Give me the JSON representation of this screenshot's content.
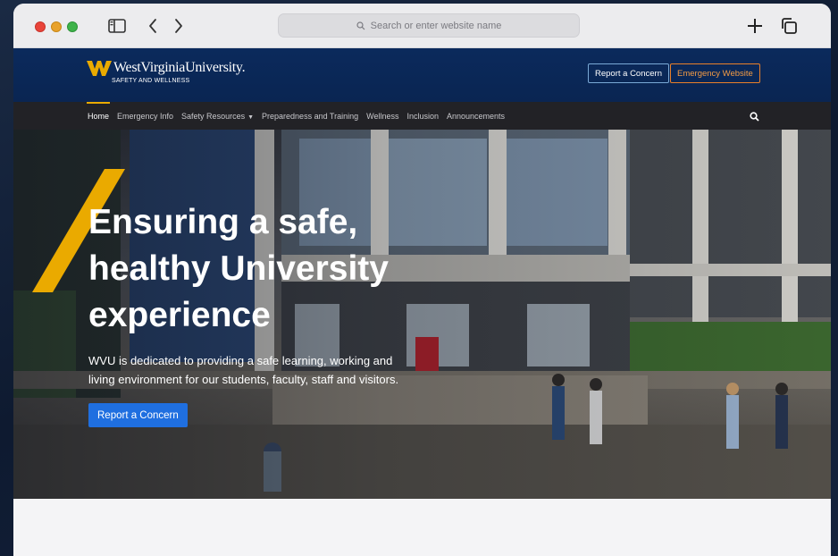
{
  "browser": {
    "url_placeholder": "Search or enter website name"
  },
  "header": {
    "university": "WestVirginiaUniversity.",
    "department": "SAFETY AND WELLNESS",
    "report_button": "Report a Concern",
    "emergency_button": "Emergency Website"
  },
  "nav": {
    "items": [
      {
        "label": "Home"
      },
      {
        "label": "Emergency Info"
      },
      {
        "label": "Safety Resources"
      },
      {
        "label": "Preparedness and Training"
      },
      {
        "label": "Wellness"
      },
      {
        "label": "Inclusion"
      },
      {
        "label": "Announcements"
      }
    ]
  },
  "hero": {
    "title": "Ensuring a safe, healthy University experience",
    "text": "WVU is dedicated to providing a safe learning, working and living environment for our students, faculty, staff and visitors.",
    "button": "Report a Concern"
  },
  "colors": {
    "brand_blue": "#0b2a5c",
    "brand_gold": "#eaaa00",
    "button_blue": "#1f6fe0",
    "emergency_orange": "#e9802a"
  }
}
